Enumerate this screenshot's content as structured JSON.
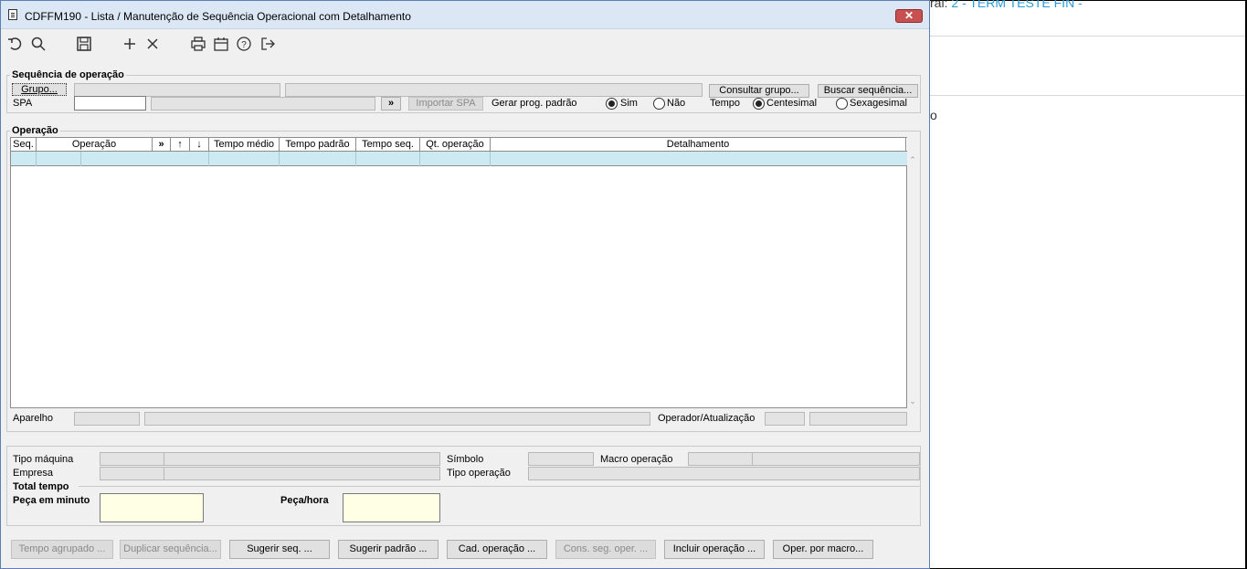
{
  "window": {
    "title": "CDFFM190 - Lista / Manutenção de Sequência Operacional com Detalhamento",
    "close_label": "✕"
  },
  "toolbar": {
    "icons": [
      "undo-icon",
      "search-icon",
      "save-icon",
      "add-icon",
      "delete-icon",
      "print-icon",
      "calendar-icon",
      "help-icon",
      "exit-icon"
    ]
  },
  "background_app": {
    "title_prefix": "ral:",
    "title_accent": "2 - TERM TESTE FIN -",
    "partial_text": "o"
  },
  "sequencia": {
    "title": "Sequência de operação",
    "grupo_button": "Grupo...",
    "consultar_grupo_button": "Consultar grupo...",
    "buscar_sequencia_button": "Buscar sequência...",
    "spa_label": "SPA",
    "spa_value": "",
    "spa_go_button": "»",
    "importar_spa_button": "Importar SPA",
    "gerar_label": "Gerar prog. padrão",
    "sim_label": "Sim",
    "nao_label": "Não",
    "gerar_selected": "Sim",
    "tempo_label": "Tempo",
    "centesimal_label": "Centesimal",
    "sexagesimal_label": "Sexagesimal",
    "tempo_selected": "Centesimal"
  },
  "operacao": {
    "title": "Operação",
    "columns": [
      "Seq.",
      "Operação",
      "»",
      "↑",
      "↓",
      "Tempo médio",
      "Tempo padrão",
      "Tempo seq.",
      "Qt. operação",
      "Detalhamento"
    ],
    "rows": [
      [
        "",
        "",
        "",
        "",
        "",
        "",
        "",
        "",
        "",
        ""
      ]
    ],
    "aparelho_label": "Aparelho",
    "operador_label": "Operador/Atualização"
  },
  "detalhes": {
    "tipo_maquina_label": "Tipo máquina",
    "empresa_label": "Empresa",
    "simbolo_label": "Símbolo",
    "macro_operacao_label": "Macro operação",
    "tipo_operacao_label": "Tipo operação"
  },
  "total_tempo": {
    "title": "Total tempo",
    "peca_minuto_label": "Peça em minuto",
    "peca_minuto_value": "",
    "peca_hora_label": "Peça/hora",
    "peca_hora_value": ""
  },
  "footer_buttons": {
    "tempo_agrupado": "Tempo agrupado ...",
    "duplicar_sequencia": "Duplicar sequência...",
    "sugerir_seq": "Sugerir seq. ...",
    "sugerir_padrao": "Sugerir padrão ...",
    "cad_operacao": "Cad. operação ...",
    "cons_seq_oper": "Cons. seg. oper. ...",
    "incluir_operacao": "Incluir operação ...",
    "oper_por_macro": "Oper. por macro..."
  }
}
